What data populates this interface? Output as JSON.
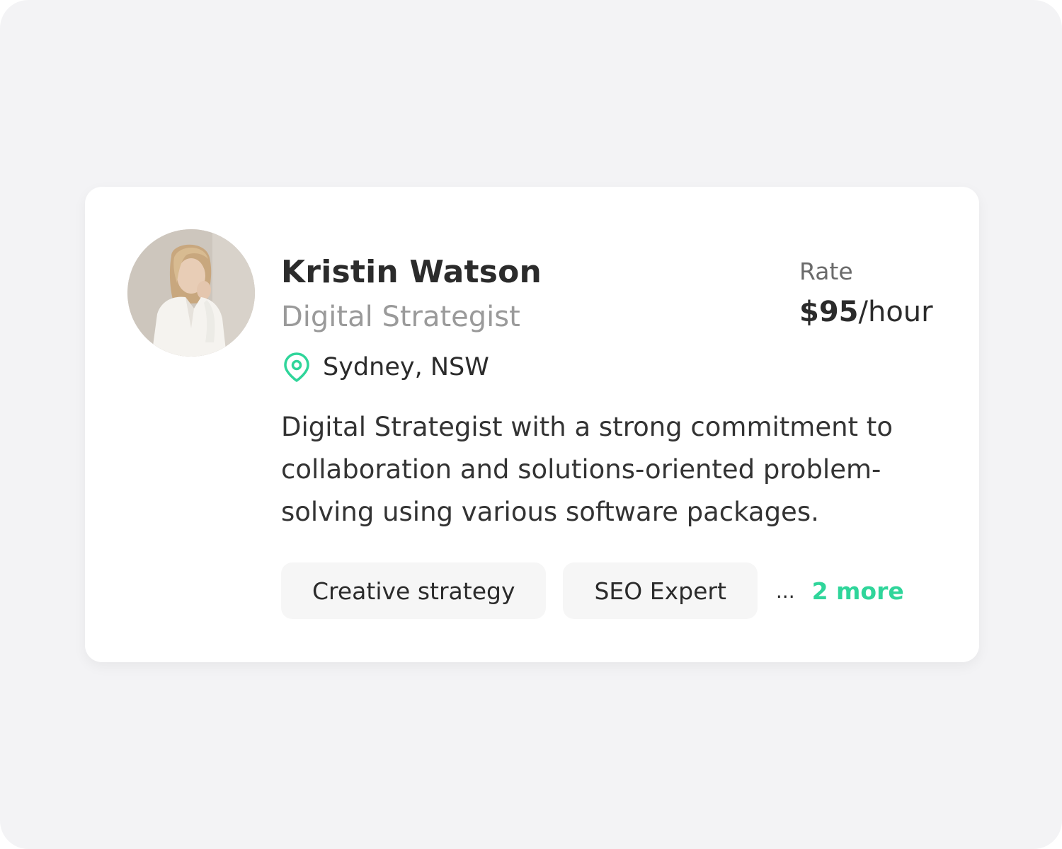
{
  "profile": {
    "name": "Kristin Watson",
    "title": "Digital Strategist",
    "location": "Sydney, NSW",
    "location_icon": "map-pin-icon",
    "rate_label": "Rate",
    "rate_amount": "$95",
    "rate_unit": "/hour",
    "description": "Digital Strategist with a strong commitment to collaboration and solutions-oriented problem-solving using various software packages.",
    "tags": [
      "Creative strategy",
      "SEO Expert"
    ],
    "ellipsis": "...",
    "more_label": "2 more"
  },
  "colors": {
    "accent": "#2fd59a",
    "page_background": "#f3f3f5",
    "card_background": "#ffffff",
    "text_primary": "#2b2b2b",
    "text_muted": "#9a9a9a",
    "tag_background": "#f6f6f6"
  }
}
